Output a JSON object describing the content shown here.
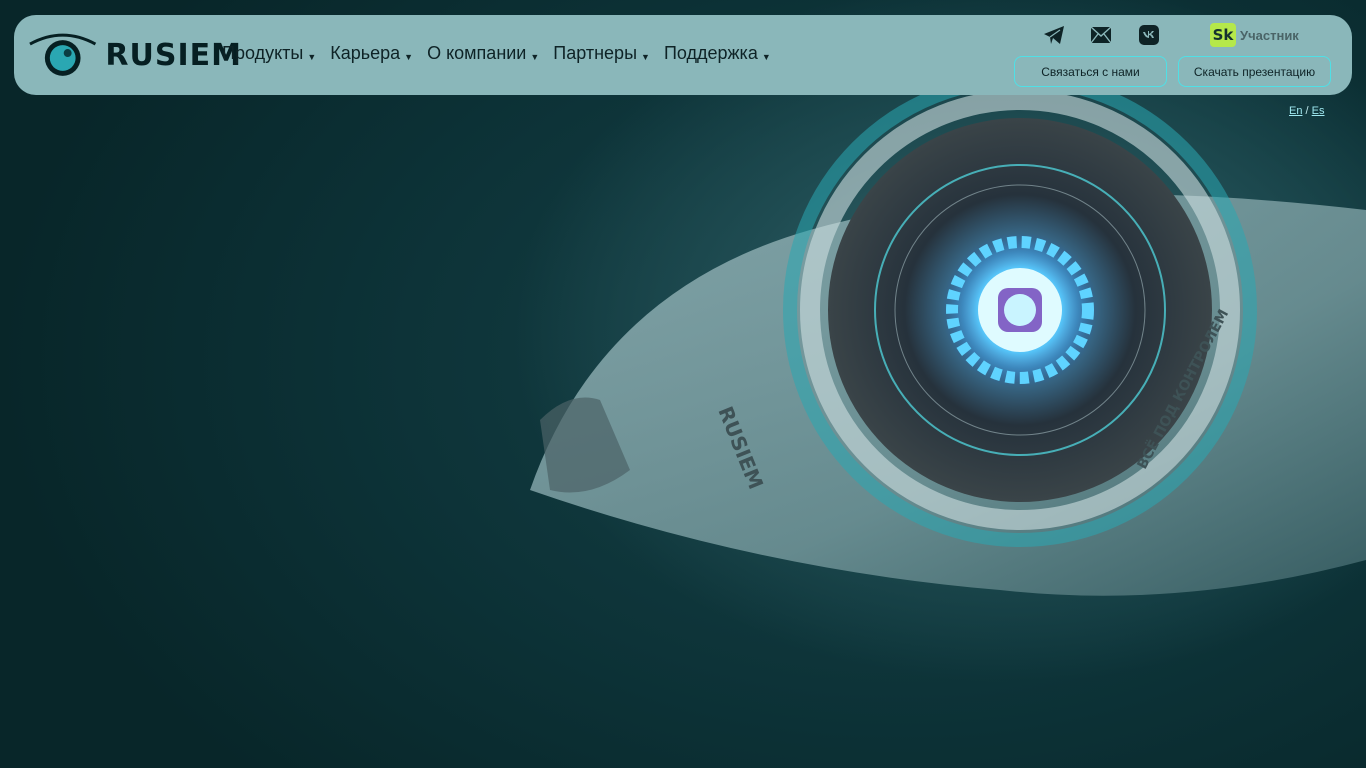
{
  "brand": {
    "name": "RUSIEM"
  },
  "nav": {
    "items": [
      {
        "label": "Продукты"
      },
      {
        "label": "Карьера"
      },
      {
        "label": "О компании"
      },
      {
        "label": "Партнеры"
      },
      {
        "label": "Поддержка"
      }
    ]
  },
  "socials": {
    "icons": [
      "telegram-icon",
      "mail-icon",
      "vk-icon"
    ]
  },
  "skolkovo": {
    "logo": "Sk",
    "label": "Участник",
    "logo_color": "#b5e84a"
  },
  "buttons": {
    "contact": "Связаться с нами",
    "presentation": "Скачать презентацию"
  },
  "language": {
    "en": "En",
    "separator": "/",
    "es": "Es"
  },
  "hero": {
    "engraving_left": "RUSIEM",
    "engraving_right": "ВСЁ ПОД КОНТРОЛЕМ"
  },
  "colors": {
    "accent": "#4fe0e6",
    "header_bg": "#8ab7ba",
    "page_bg": "#0a2e33"
  }
}
